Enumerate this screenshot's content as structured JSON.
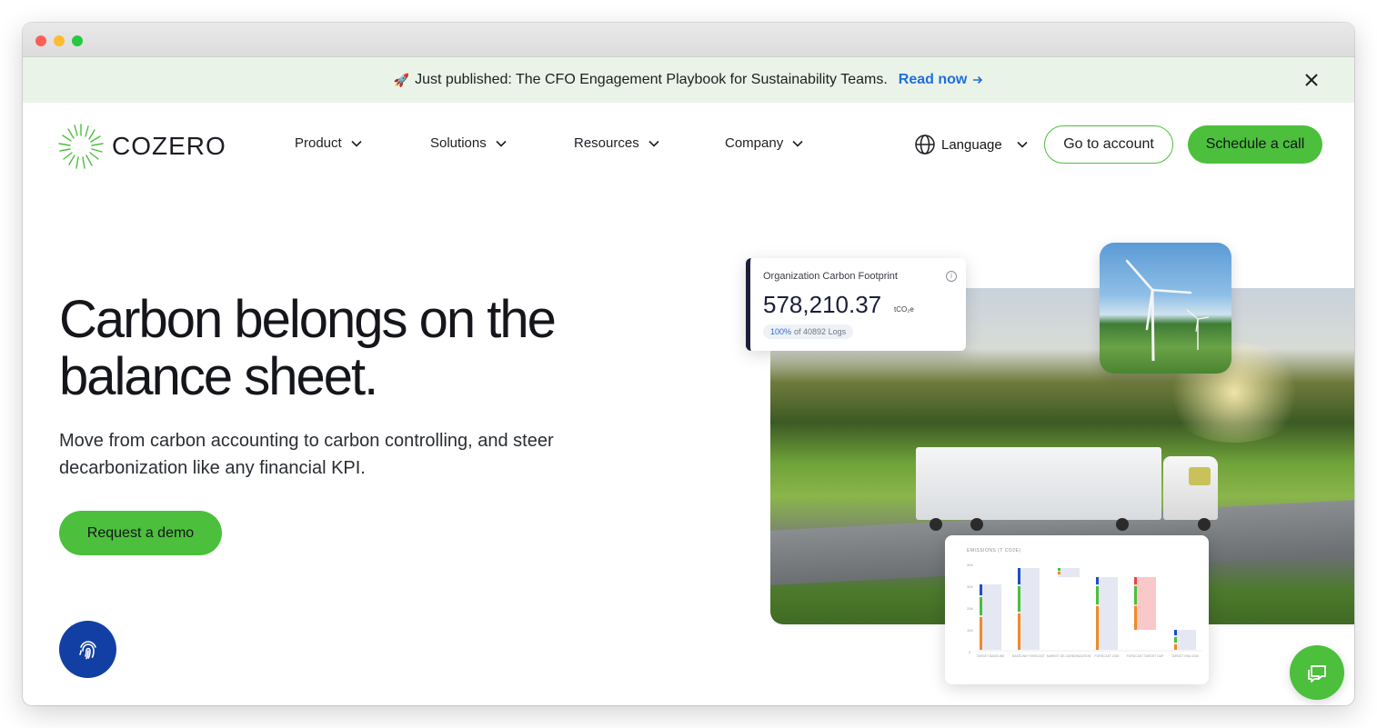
{
  "announcement": {
    "icon": "rocket-icon",
    "text": "Just published: The CFO Engagement Playbook for Sustainability Teams.",
    "link_label": "Read now"
  },
  "brand": {
    "name": "COZERO",
    "accent": "#4cbf3c"
  },
  "nav": {
    "items": [
      {
        "label": "Product"
      },
      {
        "label": "Solutions"
      },
      {
        "label": "Resources"
      },
      {
        "label": "Company"
      }
    ],
    "language_label": "Language",
    "account_button": "Go to account",
    "cta_button": "Schedule a call"
  },
  "hero": {
    "title": "Carbon belongs on the balance sheet.",
    "subtitle": "Move from carbon accounting to carbon controlling, and steer decarbonization like any financial KPI.",
    "cta": "Request a demo"
  },
  "carbon_card": {
    "label": "Organization Carbon Footprint",
    "value": "578,210.37",
    "unit": "tCO₂e",
    "coverage_pct": "100%",
    "coverage_rest": "of 40892 Logs"
  },
  "emissions_chart": {
    "title": "EMISSIONS (T CO2E)",
    "y_ticks": [
      "40K",
      "30K",
      "20K",
      "10K",
      "0"
    ],
    "categories": [
      "TARGET BASELINE",
      "BASELINE FORECAST",
      "MARKET DE-CARBONIZATION",
      "FORECAST 2030",
      "FORECAST TARGET GAP",
      "TARGET END 2030"
    ]
  }
}
